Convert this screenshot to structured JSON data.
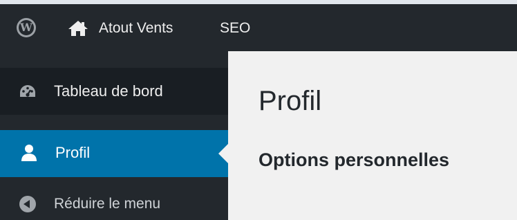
{
  "adminbar": {
    "site_name": "Atout Vents",
    "seo_label": "SEO"
  },
  "sidebar": {
    "items": [
      {
        "label": "Tableau de bord",
        "icon": "dashboard-icon"
      },
      {
        "label": "Profil",
        "icon": "user-icon",
        "active": true
      },
      {
        "label": "Réduire le menu",
        "icon": "collapse-icon"
      }
    ]
  },
  "main": {
    "title": "Profil",
    "section_title": "Options personnelles"
  },
  "colors": {
    "adminbar_bg": "#23282d",
    "menu_active_bg": "#0073aa",
    "content_bg": "#f1f1f1"
  }
}
